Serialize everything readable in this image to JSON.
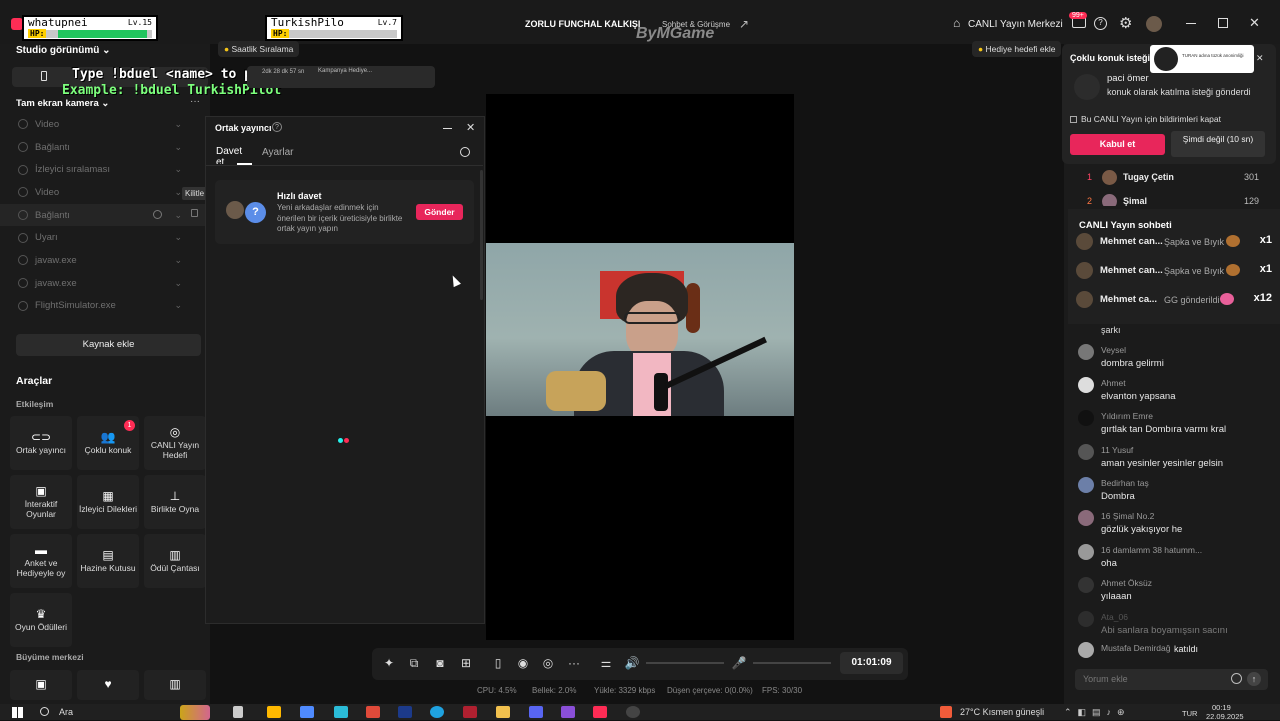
{
  "overlay": {
    "player1_name": "whatupnei",
    "player1_level": "Lv.15",
    "player1_hp_label": "HP:",
    "player1_hp_percent": 95,
    "player2_name": "TurkishPilo",
    "player2_level": "Lv.7",
    "player2_hp_label": "HP:",
    "player2_hp_percent": 0,
    "instructions_line1": "Type !bduel <name> to play",
    "instructions_line2": "Example: !bduel TurkishPilot"
  },
  "titlebar": {
    "stream_title": "ZORLU FUNCHAL KALKIŞI",
    "category": "Sohbet & Görüşme",
    "watermark": "ByMGame",
    "live_center": "CANLI Yayın Merkezi",
    "badge_count": "99+"
  },
  "sidebar": {
    "studio_view": "Studio görünümü",
    "hourly_rank": "Saatlik Sıralama",
    "fullscreen_camera": "Tam ekran kamera",
    "sources": [
      {
        "label": "Video"
      },
      {
        "label": "Bağlantı"
      },
      {
        "label": "İzleyici sıralaması"
      },
      {
        "label": "Video"
      },
      {
        "label": "Bağlantı"
      },
      {
        "label": "Uyarı"
      },
      {
        "label": "javaw.exe"
      },
      {
        "label": "javaw.exe"
      },
      {
        "label": "FlightSimulator.exe"
      }
    ],
    "lock_tooltip": "Kilitle",
    "add_source": "Kaynak ekle",
    "tools_title": "Araçlar",
    "interaction_title": "Etkileşim",
    "tools": [
      {
        "label": "Ortak yayıncı",
        "icon": "link-icon"
      },
      {
        "label": "Çoklu konuk",
        "icon": "users-icon",
        "badge": "1"
      },
      {
        "label": "CANLI Yayın Hedefi",
        "icon": "target-icon"
      },
      {
        "label": "İnteraktif Oyunlar",
        "icon": "gamepad-icon"
      },
      {
        "label": "İzleyici Dilekleri",
        "icon": "gift-icon"
      },
      {
        "label": "Birlikte Oyna",
        "icon": "joystick-icon"
      },
      {
        "label": "Anket ve Hediyeyle oy",
        "icon": "poll-icon"
      },
      {
        "label": "Hazine Kutusu",
        "icon": "chest-icon"
      },
      {
        "label": "Ödül Çantası",
        "icon": "bag-icon"
      },
      {
        "label": "Oyun Ödülleri",
        "icon": "trophy-icon"
      }
    ],
    "growth_title": "Büyüme merkezi"
  },
  "cohost_panel": {
    "title": "Ortak yayıncı",
    "tab_invite": "Davet et",
    "tab_settings": "Ayarlar",
    "quick_invite_title": "Hızlı davet",
    "quick_invite_desc": "Yeni arkadaşlar edinmek için önerilen bir içerik üreticisiyle birlikte ortak yayın yapın",
    "send_button": "Gönder"
  },
  "top_gift": {
    "timer": "2dk 28 dk 57 sn",
    "gift_text": "Kampanya Hediye...",
    "gift_goal": "Hediye hedefi ekle"
  },
  "guest_request": {
    "title": "Çoklu konuk isteği",
    "user": "paci ömer",
    "message": "konuk olarak katılma isteği gönderdi",
    "checkbox_label": "Bu CANLI Yayın için bildirimleri kapat",
    "accept": "Kabul et",
    "later": "Şimdi değil (10 sn)",
    "promo_text": "TURAN adına tüzük anonimliği"
  },
  "leaderboard": [
    {
      "rank": "1",
      "name": "Tugay Çetin",
      "score": "301"
    },
    {
      "rank": "2",
      "name": "Şimal",
      "score": "129"
    }
  ],
  "chat": {
    "title": "CANLI Yayın sohbeti",
    "gifts": [
      {
        "name": "Mehmet can...",
        "gift": "Şapka ve Bıyık",
        "count": "x1"
      },
      {
        "name": "Mehmet can...",
        "gift": "Şapka ve Bıyık",
        "count": "x1"
      },
      {
        "name": "Mehmet ca...",
        "gift": "GG gönderildi",
        "count": "x12"
      }
    ],
    "partial_text": "şarkı",
    "messages": [
      {
        "name": "Veysel",
        "text": "dombra gelirmi"
      },
      {
        "name": "Ahmet",
        "text": "elvanton yapsana"
      },
      {
        "name": "Yıldırım Emre",
        "text": "gırtlak tan Dombıra varmı kral"
      },
      {
        "name": "11 Yusuf",
        "text": "aman yesinler yesinler gelsin"
      },
      {
        "name": "Bedirhan taş",
        "text": "Dombra"
      },
      {
        "name": "16 Şimal  No.2",
        "text": "gözlük yakışıyor he"
      },
      {
        "name": "16 damlamm  38 hatumm...",
        "text": "oha"
      },
      {
        "name": "Ahmet Öksüz",
        "text": "yılaaan"
      },
      {
        "name": "Ata_06",
        "text": "Abi sanlara boyamışsın sacını"
      },
      {
        "name": "Mustafa Demirdağ",
        "text": "katıldı"
      }
    ],
    "input_placeholder": "Yorum ekle"
  },
  "controls": {
    "timer": "01:01:09"
  },
  "stats": {
    "cpu": "CPU: 4.5%",
    "memory": "Bellek: 2.0%",
    "upload": "Yükle: 3329 kbps",
    "dropped": "Düşen çerçeve: 0(0.0%)",
    "fps": "FPS: 30/30"
  },
  "taskbar": {
    "search": "Ara",
    "weather": "27°C  Kısmen güneşli",
    "lang": "TUR",
    "time": "00:19",
    "date": "22.09.2025"
  }
}
